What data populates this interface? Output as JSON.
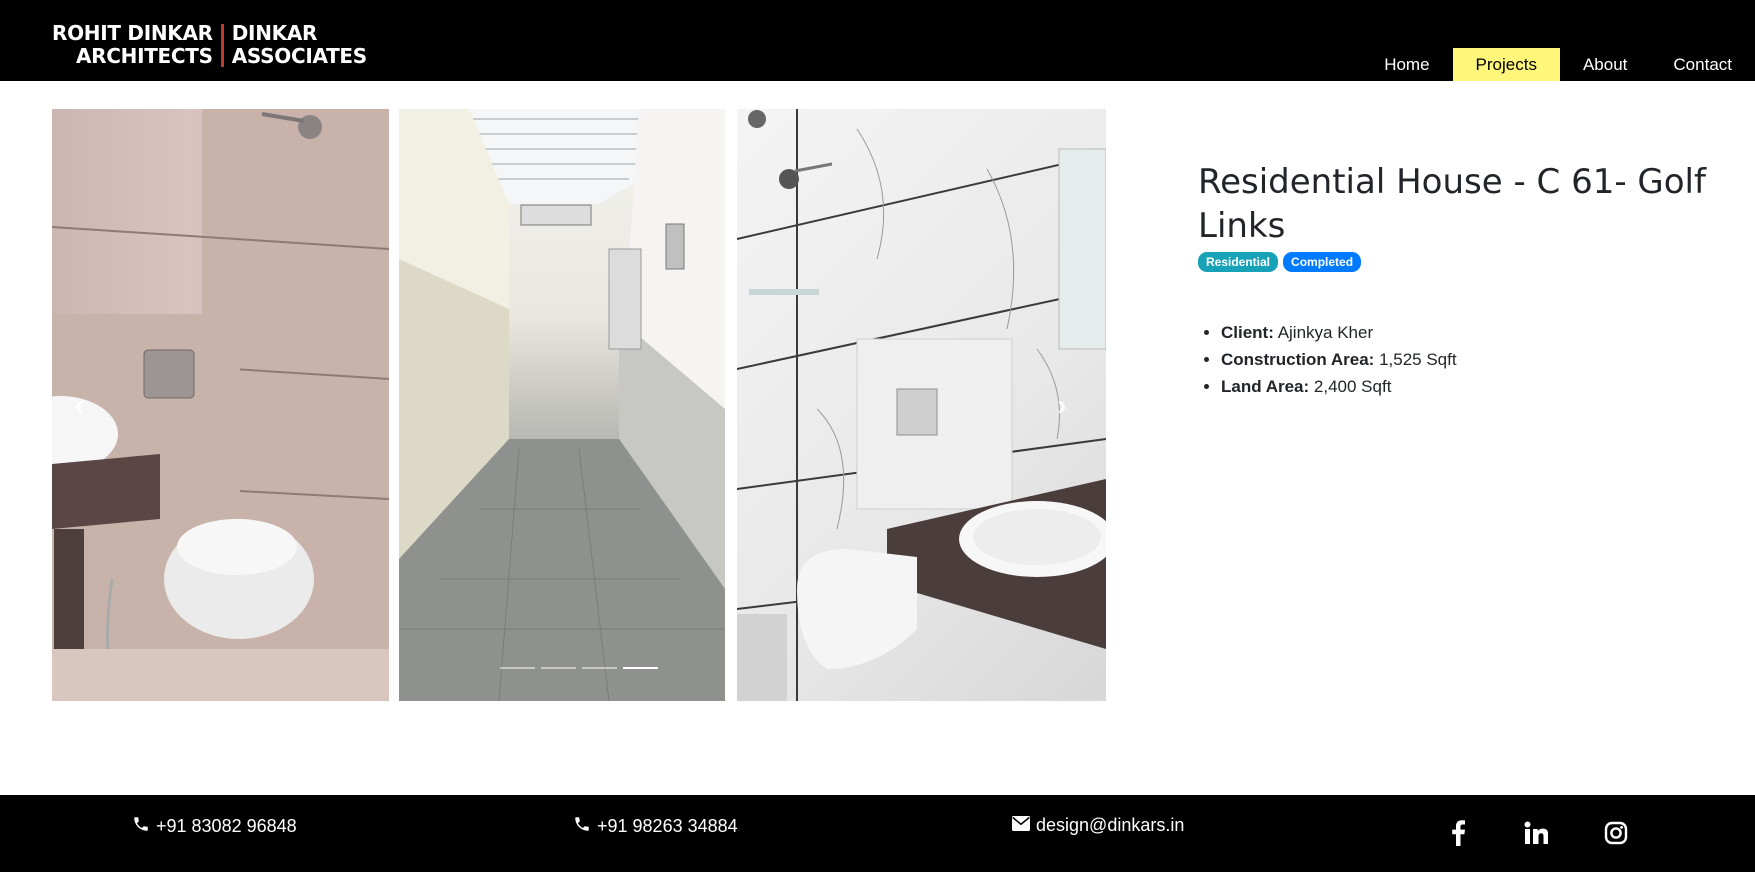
{
  "header": {
    "logo": {
      "left_line1": "ROHIT DINKAR",
      "left_line2": "ARCHITECTS",
      "right_line1": "DINKAR",
      "right_line2": "ASSOCIATES"
    },
    "nav": [
      {
        "label": "Home",
        "active": false
      },
      {
        "label": "Projects",
        "active": true
      },
      {
        "label": "About",
        "active": false
      },
      {
        "label": "Contact",
        "active": false
      }
    ]
  },
  "carousel": {
    "prev_icon": "chevron-left-icon",
    "next_icon": "chevron-right-icon",
    "indicator_count": 4,
    "active_indicator": 4
  },
  "project": {
    "title": "Residential House - C 61- Golf Links",
    "badges": [
      "Residential",
      "Completed"
    ],
    "details": [
      {
        "label": "Client:",
        "value": "Ajinkya Kher"
      },
      {
        "label": "Construction Area:",
        "value": "1,525 Sqft"
      },
      {
        "label": "Land Area:",
        "value": "2,400 Sqft"
      }
    ]
  },
  "footer": {
    "phone1": "+91 83082 96848",
    "phone2": "+91 98263 34884",
    "email": "design@dinkars.in",
    "social": [
      "facebook-icon",
      "linkedin-icon",
      "instagram-icon"
    ]
  },
  "colors": {
    "header_bg": "#000000",
    "nav_active_bg": "#fff67a",
    "badge_residential": "#17a2b8",
    "badge_completed": "#007bff",
    "logo_divider": "#c0392b"
  }
}
